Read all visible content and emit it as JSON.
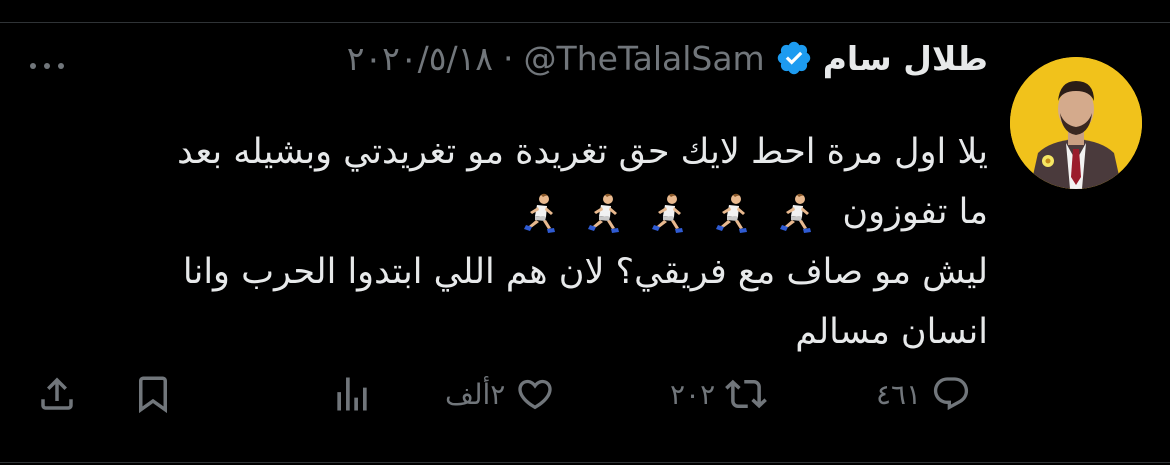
{
  "tweet": {
    "display_name": "طلال سام",
    "handle": "@TheTalalSam",
    "separator": "·",
    "date": "٢٠٢٠/٥/١٨",
    "text_lines": [
      "يلا اول مرة احط لايك حق تغريدة مو تغريدتي وبشيله بعد",
      "ما تفوزون",
      "ليش مو صاف مع فريقي؟ لان هم اللي ابتدوا الحرب وانا",
      "انسان مسالم"
    ],
    "emoji_count": 5
  },
  "icons": {
    "verified": "verified-badge-icon",
    "more": "more-icon",
    "reply": "reply-icon",
    "retweet": "retweet-icon",
    "like": "heart-icon",
    "views": "views-icon",
    "bookmark": "bookmark-icon",
    "share": "share-icon",
    "runner": "runner-emoji-icon"
  },
  "actions": {
    "reply_count": "٤٦١",
    "retweet_count": "٢٠٢",
    "like_count": "٢ألف"
  },
  "colors": {
    "background": "#000000",
    "text": "#e7e9ea",
    "secondary": "#71767b",
    "verified": "#1d9bf0",
    "avatar_bg": "#f1c21b"
  }
}
